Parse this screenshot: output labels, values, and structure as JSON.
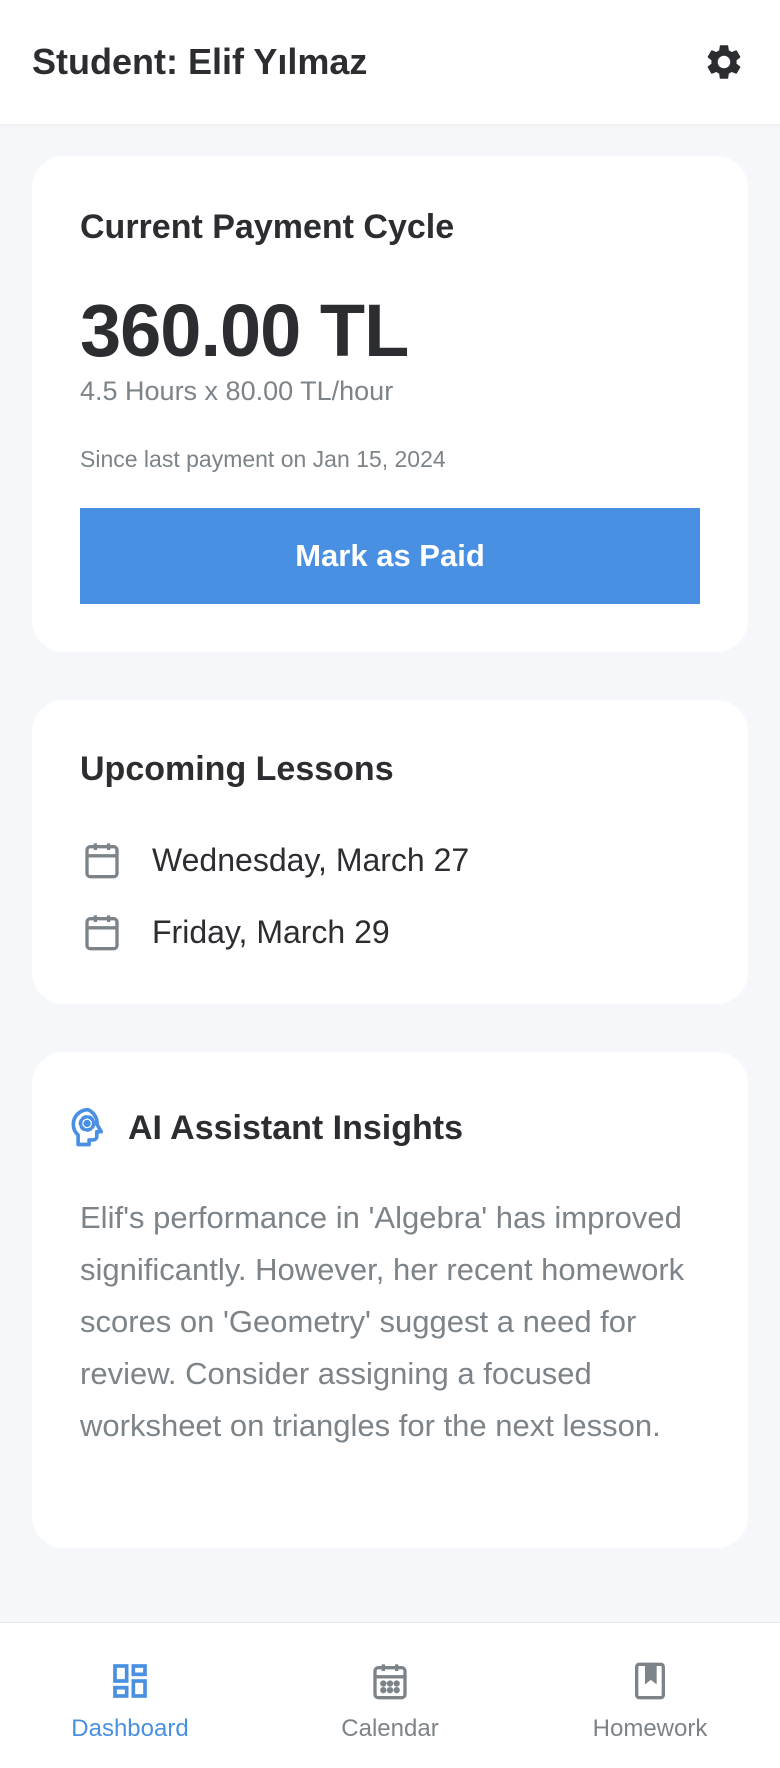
{
  "header": {
    "title": "Student: Elif Yılmaz",
    "settings_icon": "gear-icon"
  },
  "payment": {
    "title": "Current Payment Cycle",
    "amount": "360.00 TL",
    "rate": "4.5 Hours x 80.00 TL/hour",
    "since": "Since last payment on Jan 15, 2024",
    "button_label": "Mark as Paid"
  },
  "lessons": {
    "title": "Upcoming Lessons",
    "items": [
      {
        "label": "Wednesday, March 27",
        "icon": "calendar-icon"
      },
      {
        "label": "Friday, March 29",
        "icon": "calendar-icon"
      }
    ]
  },
  "ai": {
    "title": "AI Assistant Insights",
    "icon": "ai-head-icon",
    "text": "Elif's performance in 'Algebra' has improved significantly. However, her recent homework scores on 'Geometry' suggest a need for review. Consider assigning a focused worksheet on triangles for the next lesson."
  },
  "nav": {
    "items": [
      {
        "label": "Dashboard",
        "icon": "dashboard-icon",
        "active": true
      },
      {
        "label": "Calendar",
        "icon": "calendar-icon",
        "active": false
      },
      {
        "label": "Homework",
        "icon": "bookmark-icon",
        "active": false
      }
    ]
  },
  "colors": {
    "accent": "#4a90e2",
    "text": "#2b2d30",
    "muted": "#7c8489",
    "background": "#f5f7fa"
  }
}
